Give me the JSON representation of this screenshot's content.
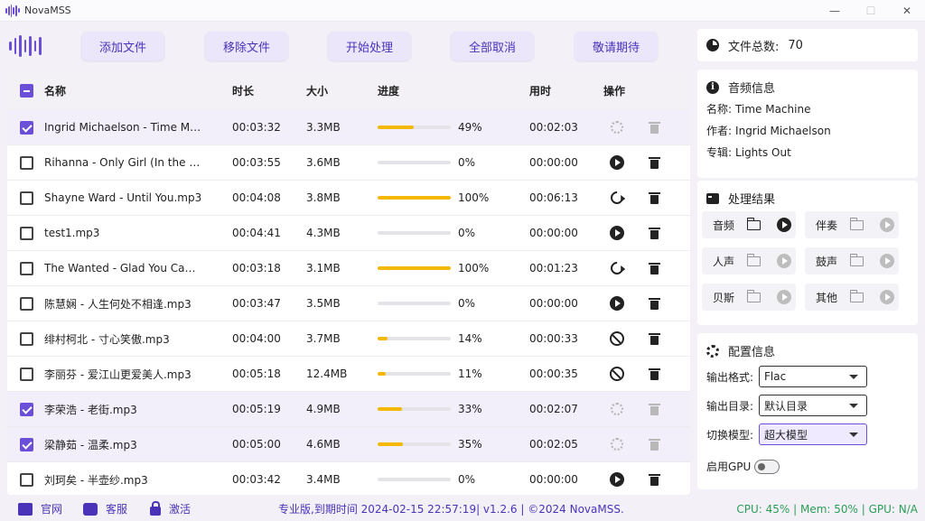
{
  "window": {
    "title": "NovaMSS"
  },
  "toolbar": {
    "buttons": [
      "添加文件",
      "移除文件",
      "开始处理",
      "全部取消",
      "敬请期待"
    ]
  },
  "table": {
    "headers": {
      "name": "名称",
      "duration": "时长",
      "size": "大小",
      "progress": "进度",
      "elapsed": "用时",
      "actions": "操作"
    },
    "rows": [
      {
        "checked": true,
        "name": "Ingrid Michaelson - Time Mac…",
        "duration": "00:03:32",
        "size": "3.3MB",
        "progress": 0.49,
        "pct": "49%",
        "elapsed": "00:02:03",
        "op": "processing"
      },
      {
        "checked": false,
        "name": "Rihanna - Only Girl (In the Wo…",
        "duration": "00:03:55",
        "size": "3.6MB",
        "progress": 0,
        "pct": "0%",
        "elapsed": "00:00:00",
        "op": "play"
      },
      {
        "checked": false,
        "name": "Shayne Ward - Until You.mp3",
        "duration": "00:04:08",
        "size": "3.8MB",
        "progress": 1.0,
        "pct": "100%",
        "elapsed": "00:06:13",
        "op": "refresh"
      },
      {
        "checked": false,
        "name": "test1.mp3",
        "duration": "00:04:41",
        "size": "4.3MB",
        "progress": 0,
        "pct": "0%",
        "elapsed": "00:00:00",
        "op": "play"
      },
      {
        "checked": false,
        "name": "The Wanted - Glad You Came.…",
        "duration": "00:03:18",
        "size": "3.1MB",
        "progress": 1.0,
        "pct": "100%",
        "elapsed": "00:01:23",
        "op": "refresh"
      },
      {
        "checked": false,
        "name": "陈慧娴 - 人生何处不相逢.mp3",
        "duration": "00:03:47",
        "size": "3.5MB",
        "progress": 0,
        "pct": "0%",
        "elapsed": "00:00:00",
        "op": "play"
      },
      {
        "checked": false,
        "name": "绯村柯北 - 寸心笑傲.mp3",
        "duration": "00:04:00",
        "size": "3.7MB",
        "progress": 0.14,
        "pct": "14%",
        "elapsed": "00:00:33",
        "op": "cancel"
      },
      {
        "checked": false,
        "name": "李丽芬 - 爱江山更爱美人.mp3",
        "duration": "00:05:18",
        "size": "12.4MB",
        "progress": 0.11,
        "pct": "11%",
        "elapsed": "00:00:35",
        "op": "cancel"
      },
      {
        "checked": true,
        "name": "李荣浩 - 老街.mp3",
        "duration": "00:05:19",
        "size": "4.9MB",
        "progress": 0.33,
        "pct": "33%",
        "elapsed": "00:02:07",
        "op": "processing"
      },
      {
        "checked": true,
        "name": "梁静茹 - 温柔.mp3",
        "duration": "00:05:00",
        "size": "4.6MB",
        "progress": 0.35,
        "pct": "35%",
        "elapsed": "00:02:05",
        "op": "processing"
      },
      {
        "checked": false,
        "name": "刘珂矣 - 半壶纱.mp3",
        "duration": "00:03:42",
        "size": "3.4MB",
        "progress": 0,
        "pct": "0%",
        "elapsed": "00:00:00",
        "op": "play"
      }
    ]
  },
  "file_count": {
    "label": "文件总数:",
    "value": "70"
  },
  "audio_info": {
    "title": "音频信息",
    "name_label": "名称:",
    "name": "Time Machine",
    "artist_label": "作者:",
    "artist": "Ingrid Michaelson",
    "album_label": "专辑:",
    "album": "Lights Out"
  },
  "result": {
    "title": "处理结果",
    "tiles": [
      {
        "label": "音频",
        "active": true
      },
      {
        "label": "伴奏",
        "active": false
      },
      {
        "label": "人声",
        "active": false
      },
      {
        "label": "鼓声",
        "active": false
      },
      {
        "label": "贝斯",
        "active": false
      },
      {
        "label": "其他",
        "active": false
      }
    ]
  },
  "config": {
    "title": "配置信息",
    "format_label": "输出格式:",
    "format": "Flac",
    "dir_label": "输出目录:",
    "dir": "默认目录",
    "model_label": "切换模型:",
    "model": "超大模型",
    "gpu_label": "启用GPU"
  },
  "footer": {
    "website": "官网",
    "support": "客服",
    "activate": "激活",
    "status": "专业版,到期时间 2024-02-15 22:57:19| v1.2.6 | ©2024 NovaMSS.",
    "usage": "CPU: 45% | Mem: 50% | GPU: N/A"
  },
  "colors": {
    "accent": "#6b4fd8",
    "progress": "#f5b800",
    "usage": "#2a9d56"
  }
}
